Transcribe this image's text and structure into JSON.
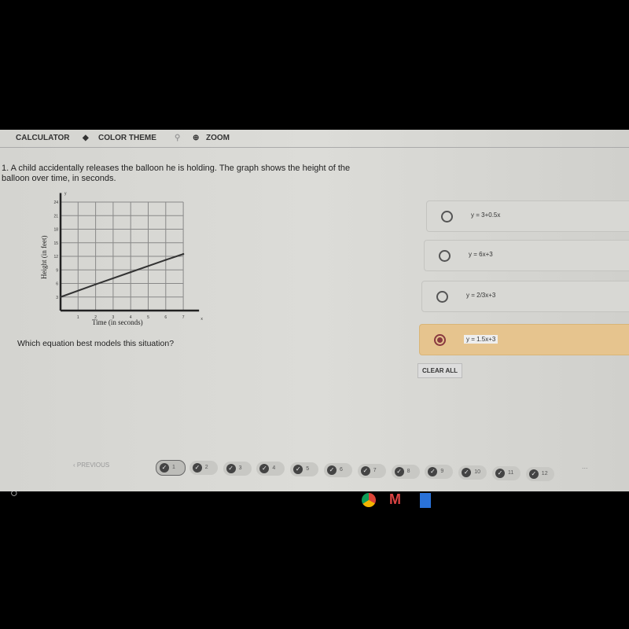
{
  "toolbar": {
    "calculator": "CALCULATOR",
    "color_theme": "COLOR THEME",
    "zoom": "ZOOM"
  },
  "question": {
    "text": "1. A child accidentally releases the balloon he is holding. The graph shows the height of the balloon over time, in seconds.",
    "prompt": "Which equation best models this situation?"
  },
  "chart_data": {
    "type": "line",
    "xlabel": "Time (in seconds)",
    "ylabel": "Height (in feet)",
    "x_axis_symbol": "x",
    "y_axis_symbol": "y",
    "xlim": [
      0,
      7
    ],
    "ylim": [
      0,
      24
    ],
    "x_ticks": [
      1,
      2,
      3,
      4,
      5,
      6,
      7
    ],
    "y_ticks": [
      3,
      6,
      9,
      12,
      15,
      18,
      21,
      24
    ],
    "grid": true,
    "series": [
      {
        "x": [
          0,
          2,
          4,
          6,
          7
        ],
        "y": [
          3,
          5.8,
          8.5,
          11.2,
          12.5
        ]
      }
    ]
  },
  "choices": [
    {
      "label": "y = 3+0.5x",
      "selected": false
    },
    {
      "label": "y = 6x+3",
      "selected": false
    },
    {
      "label": "y = 2/3x+3",
      "selected": false
    },
    {
      "label": "y = 1.5x+3",
      "selected": true
    }
  ],
  "clear_all": "CLEAR ALL",
  "nav": {
    "previous": "PREVIOUS",
    "pages": [
      "1",
      "2",
      "3",
      "4",
      "5",
      "6",
      "7",
      "8",
      "9",
      "10",
      "11",
      "12"
    ],
    "current": "1",
    "more": "..."
  },
  "colors": {
    "selected": "#e6c48e",
    "radio_selected": "#8a3a40"
  }
}
